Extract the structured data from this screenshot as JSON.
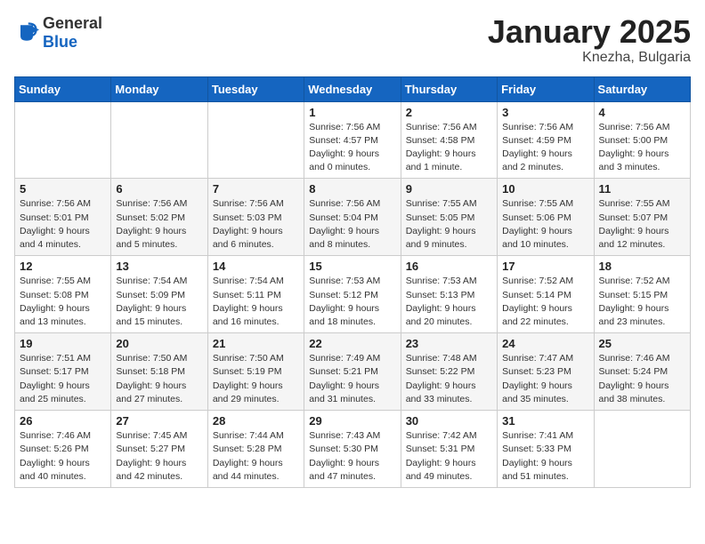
{
  "logo": {
    "general": "General",
    "blue": "Blue"
  },
  "title": {
    "month_year": "January 2025",
    "location": "Knezha, Bulgaria"
  },
  "weekdays": [
    "Sunday",
    "Monday",
    "Tuesday",
    "Wednesday",
    "Thursday",
    "Friday",
    "Saturday"
  ],
  "weeks": [
    [
      {
        "day": "",
        "info": ""
      },
      {
        "day": "",
        "info": ""
      },
      {
        "day": "",
        "info": ""
      },
      {
        "day": "1",
        "info": "Sunrise: 7:56 AM\nSunset: 4:57 PM\nDaylight: 9 hours\nand 0 minutes."
      },
      {
        "day": "2",
        "info": "Sunrise: 7:56 AM\nSunset: 4:58 PM\nDaylight: 9 hours\nand 1 minute."
      },
      {
        "day": "3",
        "info": "Sunrise: 7:56 AM\nSunset: 4:59 PM\nDaylight: 9 hours\nand 2 minutes."
      },
      {
        "day": "4",
        "info": "Sunrise: 7:56 AM\nSunset: 5:00 PM\nDaylight: 9 hours\nand 3 minutes."
      }
    ],
    [
      {
        "day": "5",
        "info": "Sunrise: 7:56 AM\nSunset: 5:01 PM\nDaylight: 9 hours\nand 4 minutes."
      },
      {
        "day": "6",
        "info": "Sunrise: 7:56 AM\nSunset: 5:02 PM\nDaylight: 9 hours\nand 5 minutes."
      },
      {
        "day": "7",
        "info": "Sunrise: 7:56 AM\nSunset: 5:03 PM\nDaylight: 9 hours\nand 6 minutes."
      },
      {
        "day": "8",
        "info": "Sunrise: 7:56 AM\nSunset: 5:04 PM\nDaylight: 9 hours\nand 8 minutes."
      },
      {
        "day": "9",
        "info": "Sunrise: 7:55 AM\nSunset: 5:05 PM\nDaylight: 9 hours\nand 9 minutes."
      },
      {
        "day": "10",
        "info": "Sunrise: 7:55 AM\nSunset: 5:06 PM\nDaylight: 9 hours\nand 10 minutes."
      },
      {
        "day": "11",
        "info": "Sunrise: 7:55 AM\nSunset: 5:07 PM\nDaylight: 9 hours\nand 12 minutes."
      }
    ],
    [
      {
        "day": "12",
        "info": "Sunrise: 7:55 AM\nSunset: 5:08 PM\nDaylight: 9 hours\nand 13 minutes."
      },
      {
        "day": "13",
        "info": "Sunrise: 7:54 AM\nSunset: 5:09 PM\nDaylight: 9 hours\nand 15 minutes."
      },
      {
        "day": "14",
        "info": "Sunrise: 7:54 AM\nSunset: 5:11 PM\nDaylight: 9 hours\nand 16 minutes."
      },
      {
        "day": "15",
        "info": "Sunrise: 7:53 AM\nSunset: 5:12 PM\nDaylight: 9 hours\nand 18 minutes."
      },
      {
        "day": "16",
        "info": "Sunrise: 7:53 AM\nSunset: 5:13 PM\nDaylight: 9 hours\nand 20 minutes."
      },
      {
        "day": "17",
        "info": "Sunrise: 7:52 AM\nSunset: 5:14 PM\nDaylight: 9 hours\nand 22 minutes."
      },
      {
        "day": "18",
        "info": "Sunrise: 7:52 AM\nSunset: 5:15 PM\nDaylight: 9 hours\nand 23 minutes."
      }
    ],
    [
      {
        "day": "19",
        "info": "Sunrise: 7:51 AM\nSunset: 5:17 PM\nDaylight: 9 hours\nand 25 minutes."
      },
      {
        "day": "20",
        "info": "Sunrise: 7:50 AM\nSunset: 5:18 PM\nDaylight: 9 hours\nand 27 minutes."
      },
      {
        "day": "21",
        "info": "Sunrise: 7:50 AM\nSunset: 5:19 PM\nDaylight: 9 hours\nand 29 minutes."
      },
      {
        "day": "22",
        "info": "Sunrise: 7:49 AM\nSunset: 5:21 PM\nDaylight: 9 hours\nand 31 minutes."
      },
      {
        "day": "23",
        "info": "Sunrise: 7:48 AM\nSunset: 5:22 PM\nDaylight: 9 hours\nand 33 minutes."
      },
      {
        "day": "24",
        "info": "Sunrise: 7:47 AM\nSunset: 5:23 PM\nDaylight: 9 hours\nand 35 minutes."
      },
      {
        "day": "25",
        "info": "Sunrise: 7:46 AM\nSunset: 5:24 PM\nDaylight: 9 hours\nand 38 minutes."
      }
    ],
    [
      {
        "day": "26",
        "info": "Sunrise: 7:46 AM\nSunset: 5:26 PM\nDaylight: 9 hours\nand 40 minutes."
      },
      {
        "day": "27",
        "info": "Sunrise: 7:45 AM\nSunset: 5:27 PM\nDaylight: 9 hours\nand 42 minutes."
      },
      {
        "day": "28",
        "info": "Sunrise: 7:44 AM\nSunset: 5:28 PM\nDaylight: 9 hours\nand 44 minutes."
      },
      {
        "day": "29",
        "info": "Sunrise: 7:43 AM\nSunset: 5:30 PM\nDaylight: 9 hours\nand 47 minutes."
      },
      {
        "day": "30",
        "info": "Sunrise: 7:42 AM\nSunset: 5:31 PM\nDaylight: 9 hours\nand 49 minutes."
      },
      {
        "day": "31",
        "info": "Sunrise: 7:41 AM\nSunset: 5:33 PM\nDaylight: 9 hours\nand 51 minutes."
      },
      {
        "day": "",
        "info": ""
      }
    ]
  ]
}
